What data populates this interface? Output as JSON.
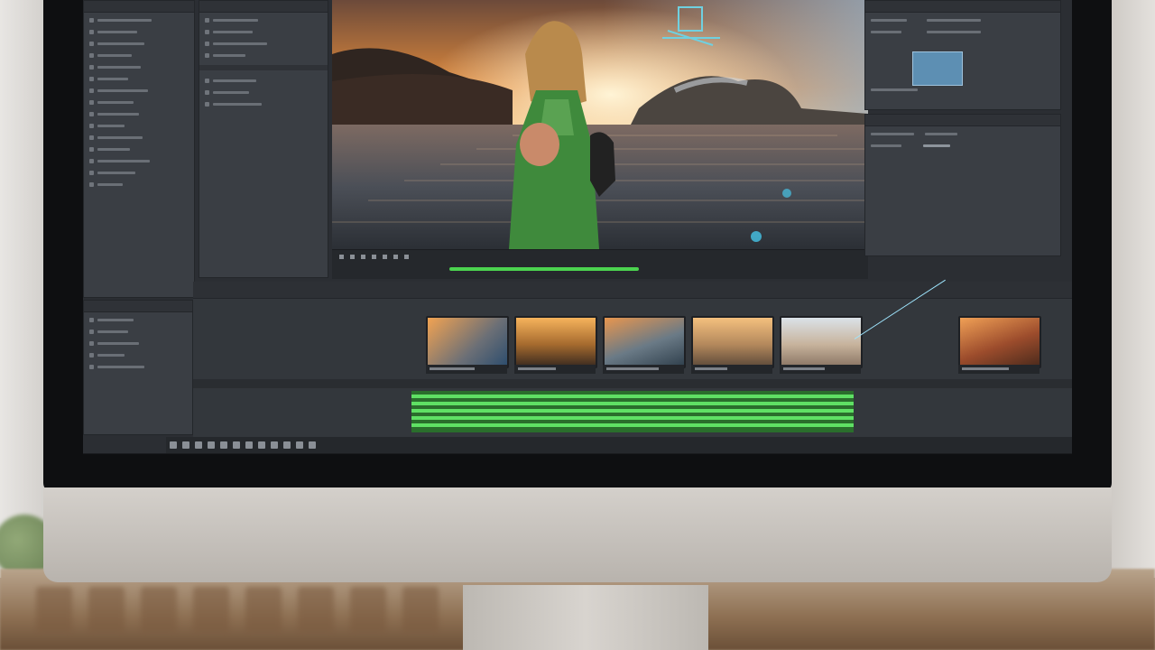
{
  "app": {
    "name": "Video editor"
  },
  "colors": {
    "accent_green": "#4bd34f",
    "panel": "#3a3e44",
    "bezel": "#0e0f11",
    "screen_bg": "#2b2e33"
  },
  "project_panel": {
    "icons": [
      "folder-icon",
      "film-icon",
      "sequence-icon",
      "chevron-right-icon"
    ]
  },
  "effects_panel": {
    "icons": [
      "effect-icon",
      "chevron-right-icon"
    ]
  },
  "inspector_panel": {
    "icons": [
      "slider-icon",
      "checkbox-icon",
      "dropdown-icon"
    ]
  },
  "viewer": {
    "description_icons": [
      "play-icon",
      "rewind-icon",
      "forward-icon"
    ],
    "playhead_percent": 36
  },
  "timeline": {
    "clips": [
      {
        "name": "clip-1",
        "theme": "lake"
      },
      {
        "name": "clip-2",
        "theme": "sunset-robot"
      },
      {
        "name": "clip-3",
        "theme": "coast"
      },
      {
        "name": "clip-4",
        "theme": "sunset-figure"
      },
      {
        "name": "clip-5",
        "theme": "sky-figure"
      },
      {
        "name": "clip-6",
        "theme": "desert-fire"
      }
    ]
  },
  "bottom_toolbar": {
    "icons": [
      "play-icon",
      "stop-icon",
      "scissors-icon",
      "magnet-icon",
      "zoom-icon",
      "settings-icon"
    ]
  }
}
